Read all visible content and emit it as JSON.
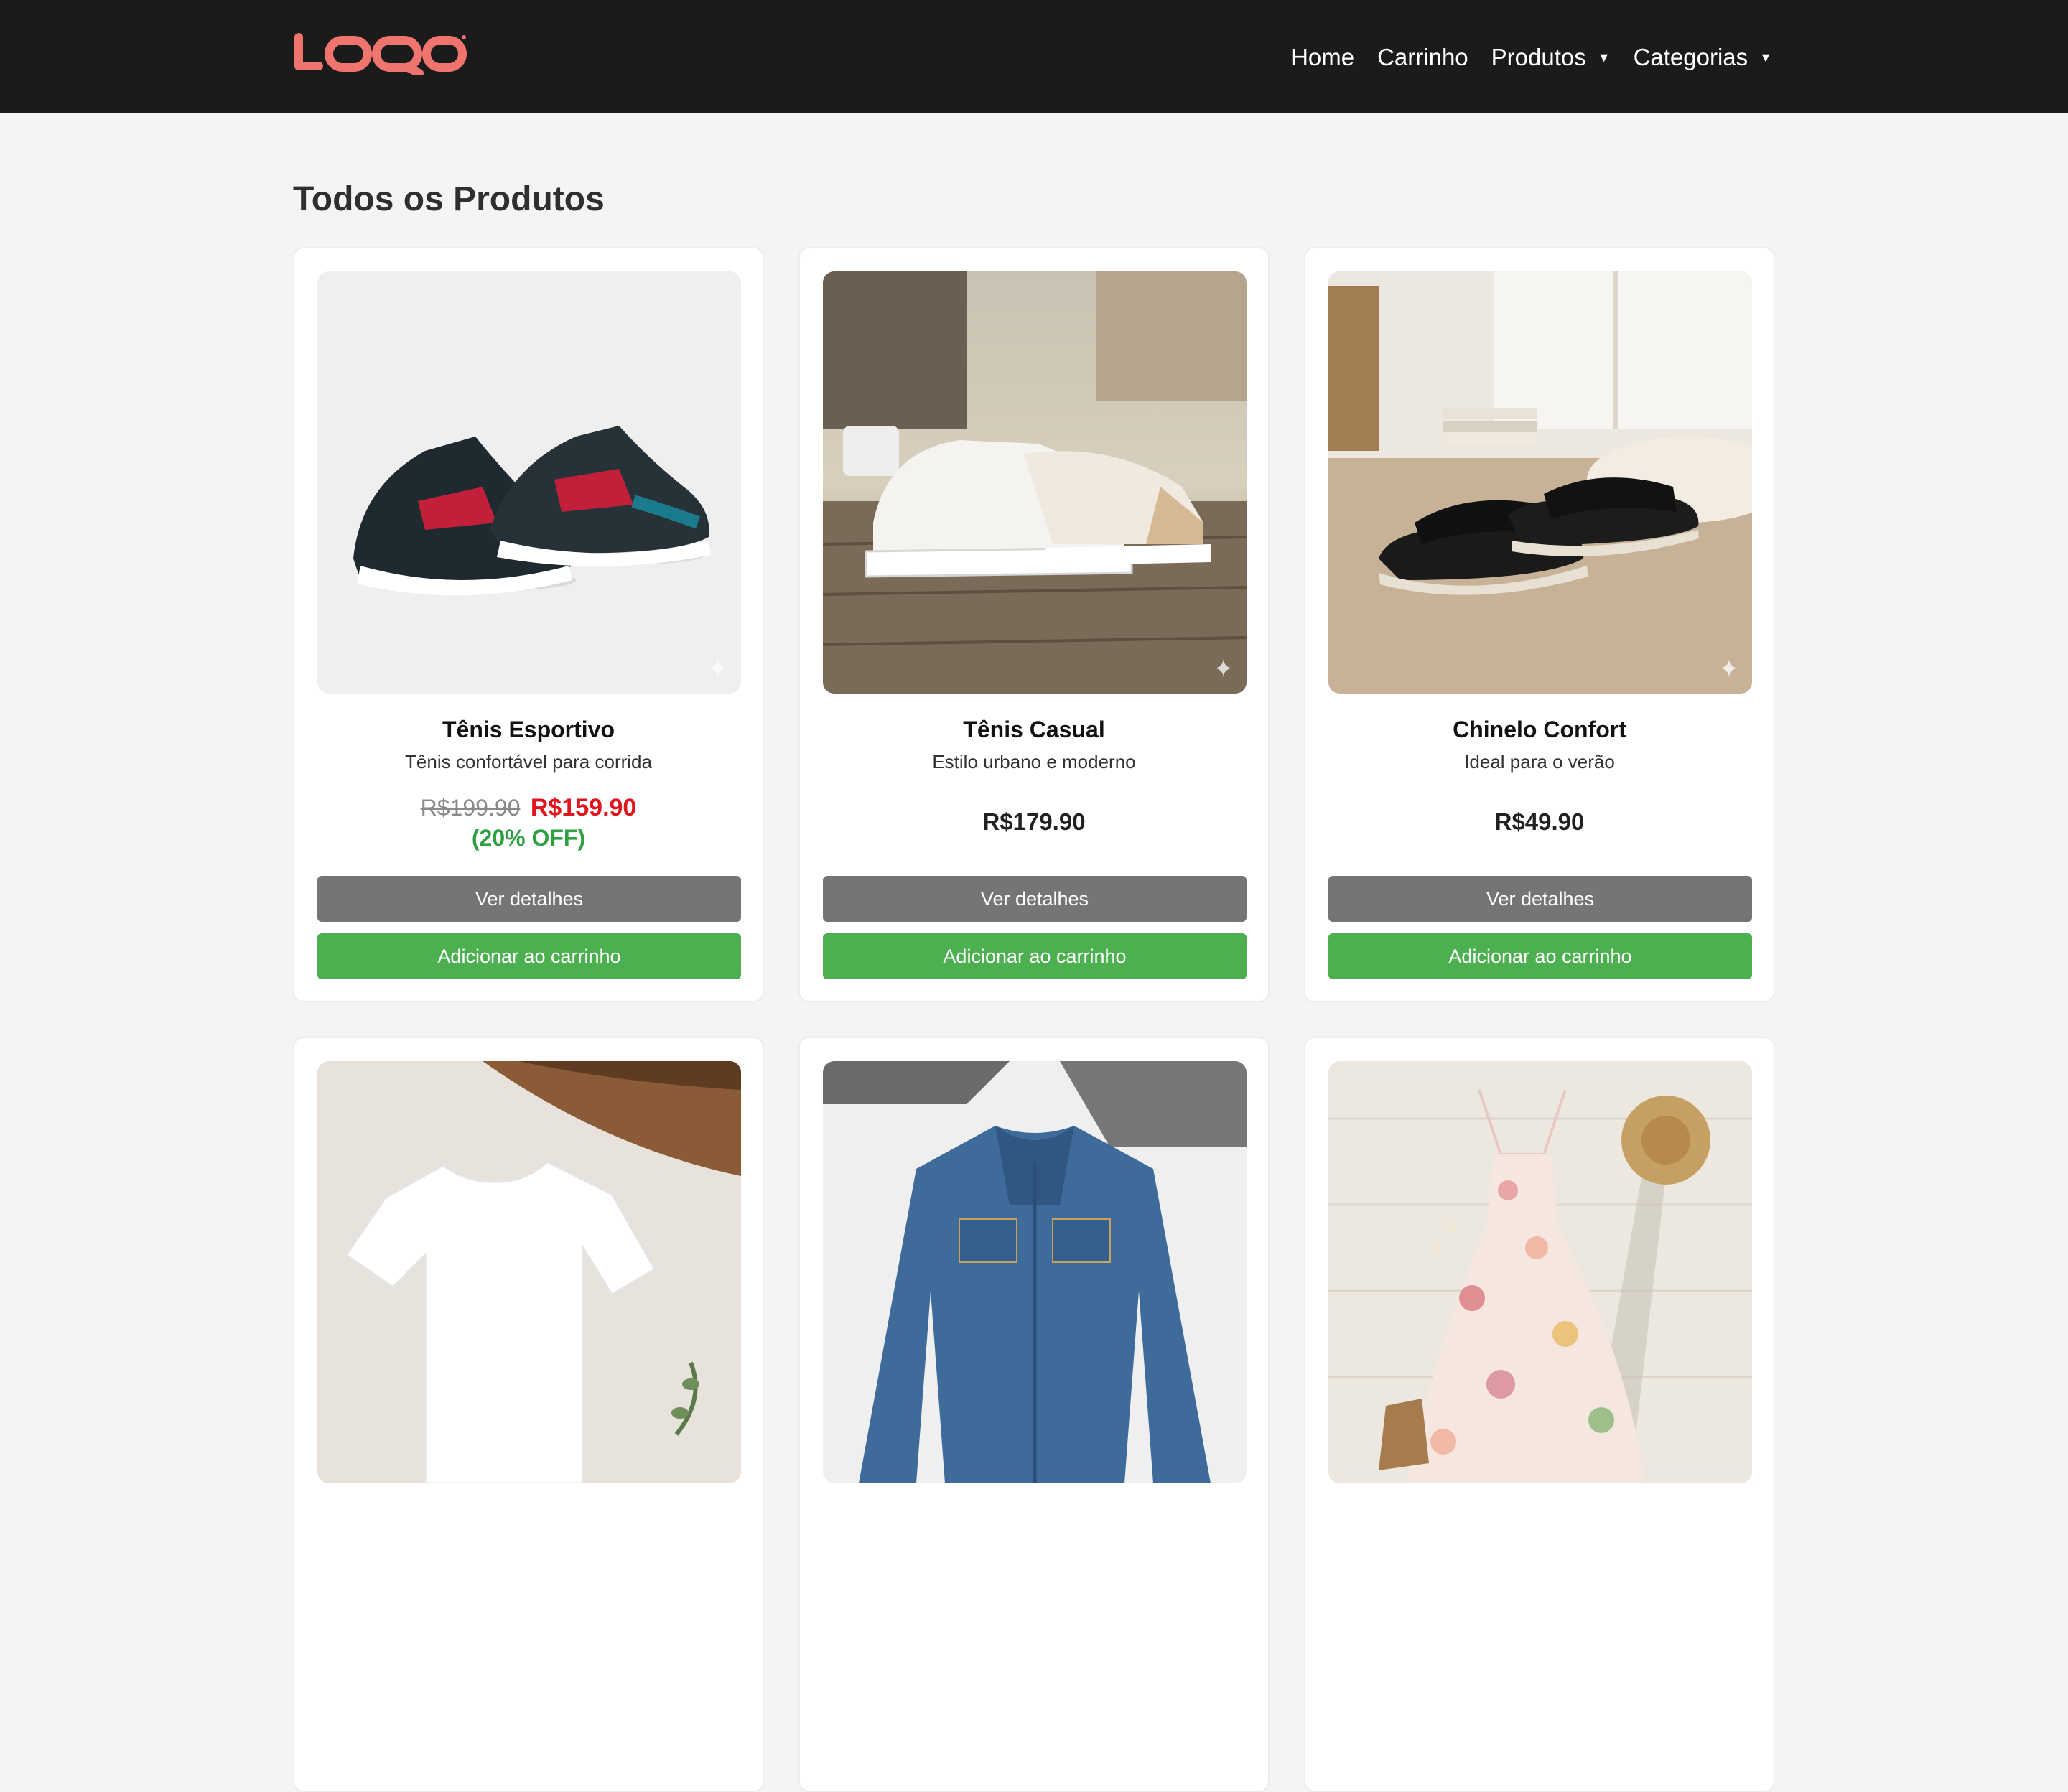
{
  "header": {
    "logo_text": "LOQO",
    "nav": [
      {
        "label": "Home",
        "has_dropdown": false
      },
      {
        "label": "Carrinho",
        "has_dropdown": false
      },
      {
        "label": "Produtos",
        "has_dropdown": true
      },
      {
        "label": "Categorias",
        "has_dropdown": true
      }
    ],
    "caret": "▼"
  },
  "main": {
    "title": "Todos os Produtos",
    "products": [
      {
        "name": "Tênis Esportivo",
        "description": "Tênis confortável para corrida",
        "price_old": "R$199.90",
        "price": "R$159.90",
        "discount": "(20% OFF)",
        "details_label": "Ver detalhes",
        "cart_label": "Adicionar ao carrinho"
      },
      {
        "name": "Tênis Casual",
        "description": "Estilo urbano e moderno",
        "price": "R$179.90",
        "details_label": "Ver detalhes",
        "cart_label": "Adicionar ao carrinho"
      },
      {
        "name": "Chinelo Confort",
        "description": "Ideal para o verão",
        "price": "R$49.90",
        "details_label": "Ver detalhes",
        "cart_label": "Adicionar ao carrinho"
      }
    ]
  },
  "colors": {
    "navbar": "#1b1b1b",
    "logo": "#f0746e",
    "details_button": "#757575",
    "cart_button": "#4caf50",
    "sale_price": "#e0141c",
    "discount": "#2fa042"
  },
  "icons": {
    "sparkle": "✦"
  }
}
